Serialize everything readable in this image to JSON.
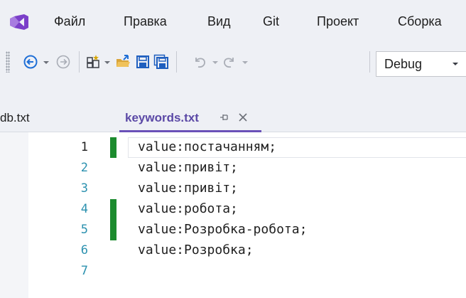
{
  "menu": {
    "items": [
      "Файл",
      "Правка",
      "Вид",
      "Git",
      "Проект",
      "Сборка"
    ]
  },
  "toolbar": {
    "config_value": "Debug",
    "icons": [
      "back-icon",
      "dropdown-arrow-icon",
      "forward-icon",
      "new-project-icon",
      "open-folder-icon",
      "save-icon",
      "save-all-icon",
      "undo-icon",
      "redo-icon"
    ]
  },
  "tabs": [
    {
      "label": "db.txt",
      "active": false
    },
    {
      "label": "keywords.txt",
      "active": true
    }
  ],
  "editor": {
    "lines": [
      {
        "number": "1",
        "text": "value:постачанням;",
        "changed": true
      },
      {
        "number": "2",
        "text": "value:привіт;",
        "changed": false
      },
      {
        "number": "3",
        "text": "value:привіт;",
        "changed": false
      },
      {
        "number": "4",
        "text": "value:робота;",
        "changed": true
      },
      {
        "number": "5",
        "text": "value:Розробка-робота;",
        "changed": true
      },
      {
        "number": "6",
        "text": "value:Розробка;",
        "changed": false
      },
      {
        "number": "7",
        "text": "",
        "changed": false
      }
    ],
    "colors": {
      "line_number": "#2b91af",
      "change_marker": "#1c8b2e",
      "active_tab": "#5b49a6"
    }
  }
}
